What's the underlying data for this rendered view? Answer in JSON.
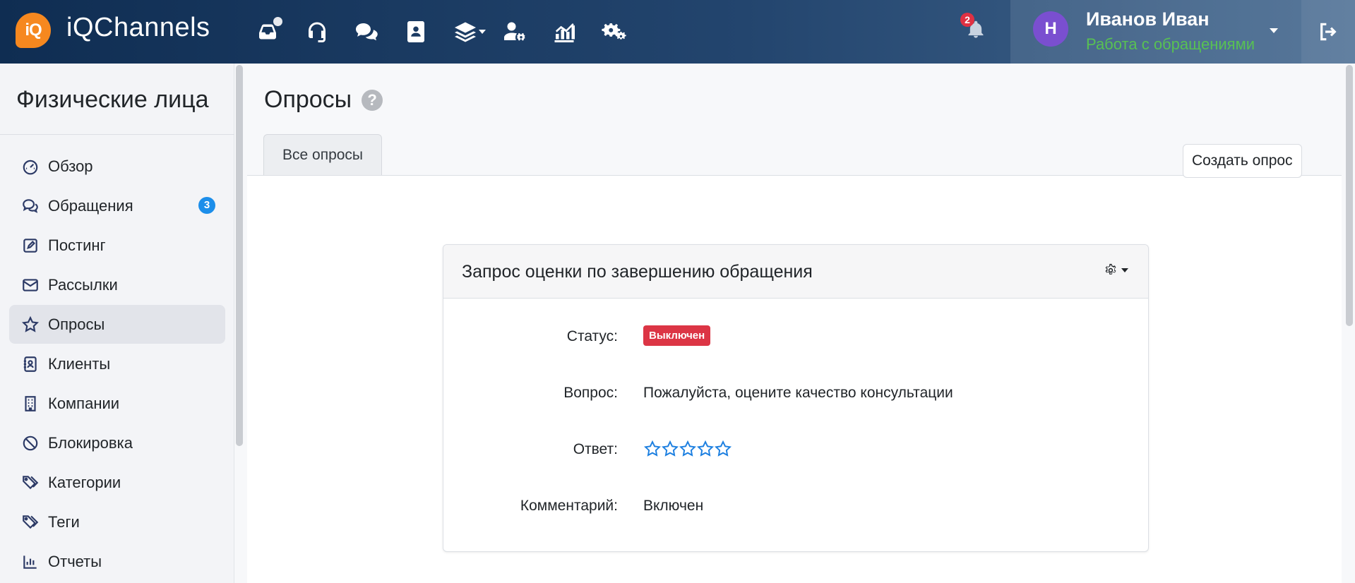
{
  "topbar": {
    "logo_text": "iQ",
    "brand": "iQChannels",
    "nav_icons": [
      {
        "icon": "inbox-icon",
        "has_dot": true
      },
      {
        "icon": "headset-icon"
      },
      {
        "icon": "chats-icon"
      },
      {
        "icon": "contacts-icon"
      },
      {
        "icon": "layers-icon",
        "has_caret": true
      },
      {
        "icon": "user-cog-icon"
      },
      {
        "icon": "analytics-icon"
      },
      {
        "icon": "settings-icon"
      }
    ],
    "notifications_count": "2",
    "user": {
      "avatar_letter": "H",
      "name": "Иванов Иван",
      "status": "Работа с обращениями"
    }
  },
  "sidebar": {
    "title": "Физические лица",
    "items": [
      {
        "label": "Обзор",
        "icon": "dashboard-icon",
        "active": false
      },
      {
        "label": "Обращения",
        "icon": "chat-bubbles-icon",
        "badge": "3",
        "active": false
      },
      {
        "label": "Постинг",
        "icon": "edit-icon",
        "active": false
      },
      {
        "label": "Рассылки",
        "icon": "envelope-icon",
        "active": false
      },
      {
        "label": "Опросы",
        "icon": "star-icon",
        "active": true
      },
      {
        "label": "Клиенты",
        "icon": "contact-card-icon",
        "active": false
      },
      {
        "label": "Компании",
        "icon": "building-icon",
        "active": false
      },
      {
        "label": "Блокировка",
        "icon": "ban-icon",
        "active": false
      },
      {
        "label": "Категории",
        "icon": "tags-icon",
        "active": false
      },
      {
        "label": "Теги",
        "icon": "tags-icon",
        "active": false
      },
      {
        "label": "Отчеты",
        "icon": "bar-chart-icon",
        "active": false
      }
    ]
  },
  "main": {
    "title": "Опросы",
    "help_symbol": "?",
    "tabs": [
      {
        "label": "Все опросы",
        "active": true
      }
    ],
    "create_button": "Создать опрос",
    "survey_card": {
      "title": "Запрос оценки по завершению обращения",
      "status_label": "Статус:",
      "status_value": "Выключен",
      "question_label": "Вопрос:",
      "question_value": "Пожалуйста, оцените качество консультации",
      "answer_label": "Ответ:",
      "answer_stars": 5,
      "comment_label": "Комментарий:",
      "comment_value": "Включен"
    }
  },
  "colors": {
    "accent_orange": "#f6881f",
    "status_green": "#58c153",
    "badge_red": "#dc3545",
    "badge_blue": "#1c8eea",
    "star_blue": "#1c7fe0"
  }
}
